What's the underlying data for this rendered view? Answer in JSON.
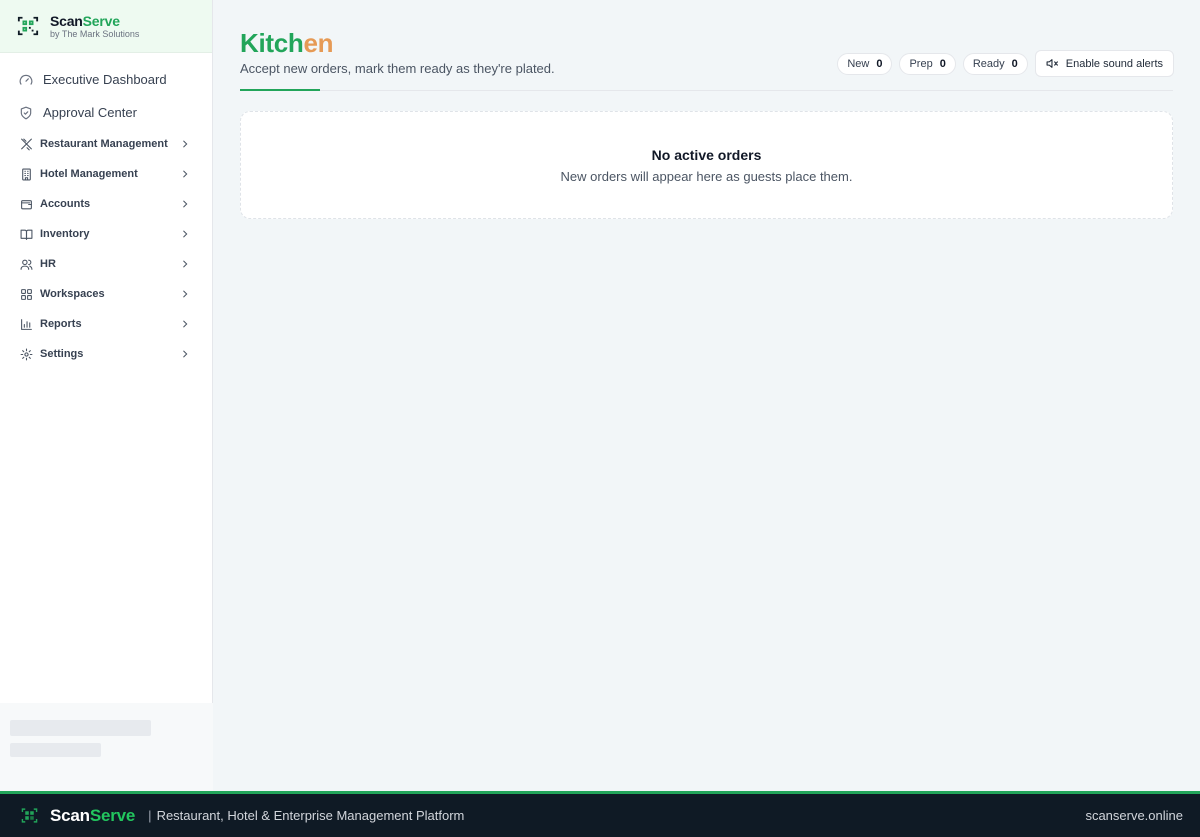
{
  "brand": {
    "name_part1": "Scan",
    "name_part2": "Serve",
    "subtitle": "by The Mark Solutions"
  },
  "sidebar": {
    "top_items": [
      {
        "label": "Executive Dashboard",
        "icon": "dashboard-gauge-icon"
      },
      {
        "label": "Approval Center",
        "icon": "shield-check-icon"
      }
    ],
    "sections": [
      {
        "label": "Restaurant Management",
        "icon": "utensils-icon"
      },
      {
        "label": "Hotel Management",
        "icon": "building-icon"
      },
      {
        "label": "Accounts",
        "icon": "wallet-icon"
      },
      {
        "label": "Inventory",
        "icon": "book-open-icon"
      },
      {
        "label": "HR",
        "icon": "users-icon"
      },
      {
        "label": "Workspaces",
        "icon": "grid-icon"
      },
      {
        "label": "Reports",
        "icon": "bar-chart-icon"
      },
      {
        "label": "Settings",
        "icon": "gear-icon"
      }
    ]
  },
  "page": {
    "title_part1": "Kitch",
    "title_part2": "en",
    "subtitle": "Accept new orders, mark them ready as they're plated."
  },
  "status": {
    "new_label": "New",
    "new_count": "0",
    "prep_label": "Prep",
    "prep_count": "0",
    "ready_label": "Ready",
    "ready_count": "0",
    "sound_label": "Enable sound alerts"
  },
  "empty": {
    "title": "No active orders",
    "subtitle": "New orders will appear here as guests place them."
  },
  "footer": {
    "brand_part1": "Scan",
    "brand_part2": "Serve",
    "separator": "|",
    "tagline": "Restaurant, Hotel & Enterprise Management Platform",
    "site": "scanserve.online"
  },
  "colors": {
    "accent_green": "#22a55a",
    "title_orange": "#e69a55",
    "footer_bg": "#0f1a25"
  }
}
